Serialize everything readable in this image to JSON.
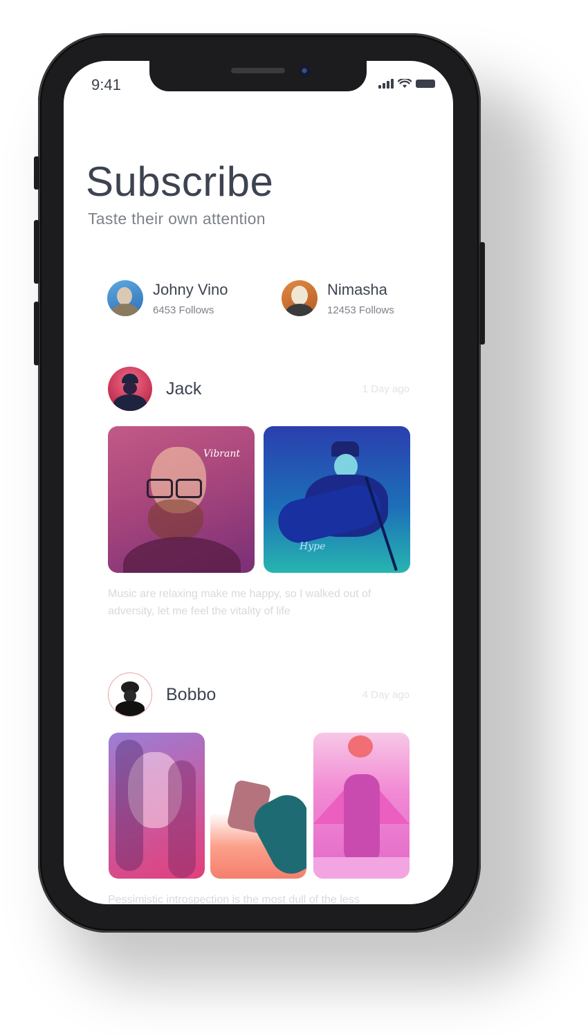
{
  "status_bar": {
    "time": "9:41"
  },
  "header": {
    "title": "Subscribe",
    "subtitle": "Taste their own attention"
  },
  "featured_users": [
    {
      "name": "Johny Vino",
      "follows": "6453 Follows"
    },
    {
      "name": "Nimasha",
      "follows": "12453 Follows"
    }
  ],
  "posts": [
    {
      "author": "Jack",
      "time_ago": "1 Day ago",
      "text": "Music are relaxing make me happy, so I walked out of adversity, let me feel the vitality of life",
      "images": [
        {
          "caption": "Vibrant"
        },
        {
          "caption": "Hype"
        }
      ]
    },
    {
      "author": "Bobbo",
      "time_ago": "4 Day ago",
      "text": "Pessimistic introspection is the most dull of the less"
    }
  ]
}
